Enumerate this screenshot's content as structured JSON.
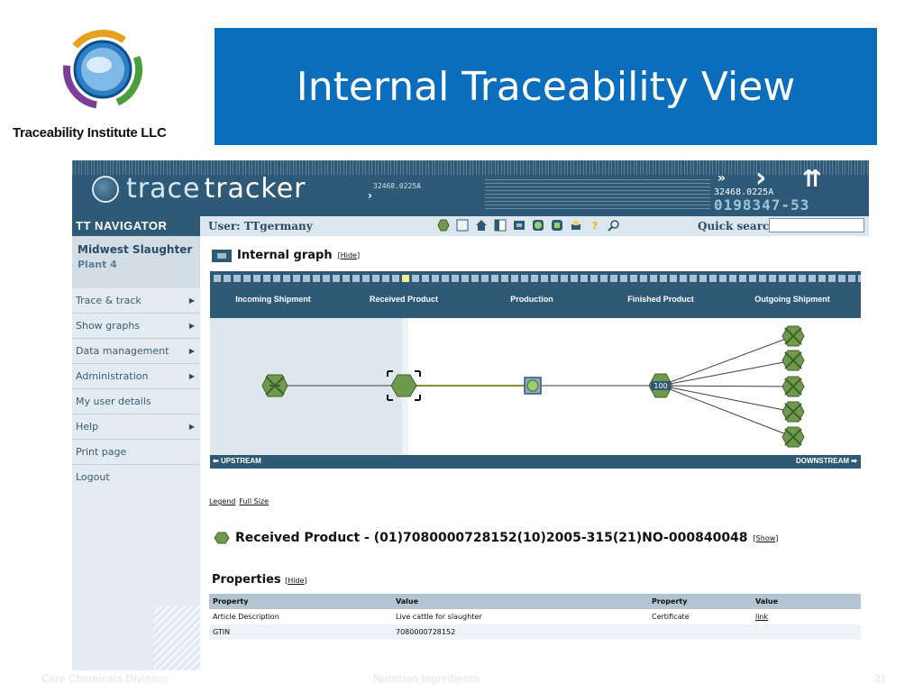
{
  "slide": {
    "title": "Internal Traceability View",
    "logo_caption": "Traceability Institute LLC",
    "footer_left": "Care Chemicals Division",
    "footer_mid": "Nutrition Ingredients",
    "page_number": "31"
  },
  "banner": {
    "brand_part1": "trace",
    "brand_part2": "tracker",
    "code_small": "32468.0225A",
    "code_right": "32468.0225A",
    "code_big": "0198347-53"
  },
  "nav": {
    "title": "TT NAVIGATOR",
    "user": "User: TTgermany",
    "quick_search_label": "Quick search",
    "quick_search_value": ""
  },
  "sidebar": {
    "company": "Midwest Slaughter",
    "plant": "Plant 4",
    "items": [
      {
        "label": "Trace & track",
        "submenu": true
      },
      {
        "label": "Show graphs",
        "submenu": true
      },
      {
        "label": "Data management",
        "submenu": true
      },
      {
        "label": "Administration",
        "submenu": true
      },
      {
        "label": "My user details",
        "submenu": false
      },
      {
        "label": "Help",
        "submenu": true
      },
      {
        "label": "Print page",
        "submenu": false
      },
      {
        "label": "Logout",
        "submenu": false
      }
    ]
  },
  "graph": {
    "title": "Internal graph",
    "hide_link": "Hide",
    "stages": [
      "Incoming Shipment",
      "Received Product",
      "Production",
      "Finished Product",
      "Outgoing Shipment"
    ],
    "finished_count": "100",
    "upstream": "UPSTREAM",
    "downstream": "DOWNSTREAM"
  },
  "links": {
    "legend": "Legend",
    "full_size": "Full Size"
  },
  "selected": {
    "title": "Received Product - (01)7080000728152(10)2005-315(21)NO-000840048",
    "show_link": "Show"
  },
  "properties": {
    "title": "Properties",
    "hide_link": "Hide",
    "headers": [
      "Property",
      "Value",
      "Property",
      "Value"
    ],
    "rows": [
      [
        "Article Description",
        "Live cattle for slaughter",
        "Certificate",
        "link"
      ],
      [
        "GTIN",
        "7080000728152",
        "",
        ""
      ]
    ]
  },
  "colors": {
    "title_bg": "#0a6ebd",
    "app_dark": "#2f5a75",
    "node_green": "#6f9a4e"
  }
}
